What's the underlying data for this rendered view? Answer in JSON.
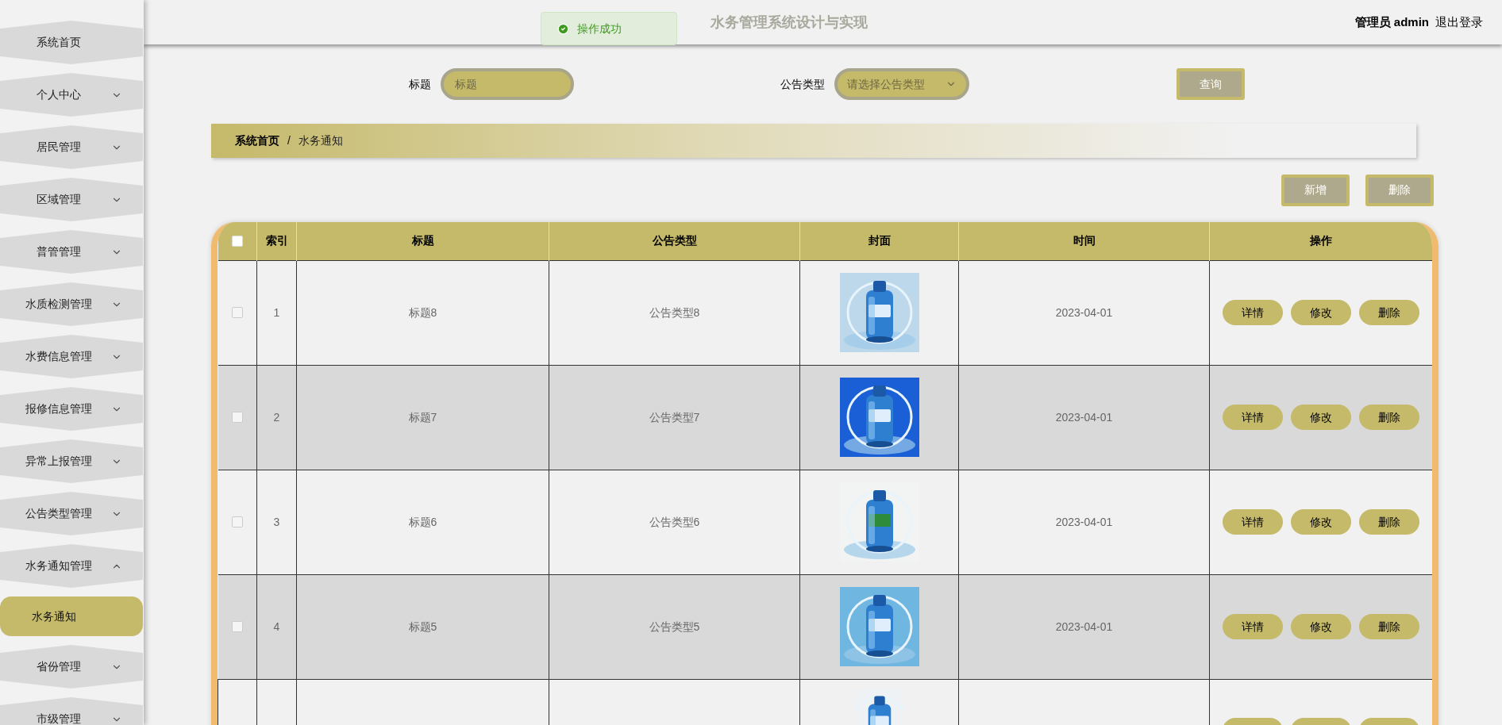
{
  "header": {
    "title": "水务管理系统设计与实现",
    "user": "管理员 admin",
    "logout": "退出登录"
  },
  "toast": {
    "message": "操作成功"
  },
  "sidebar": {
    "items": [
      {
        "label": "系统首页",
        "kind": "link"
      },
      {
        "label": "个人中心",
        "kind": "menu",
        "expanded": false
      },
      {
        "label": "居民管理",
        "kind": "menu",
        "expanded": false
      },
      {
        "label": "区域管理",
        "kind": "menu",
        "expanded": false
      },
      {
        "label": "普管管理",
        "kind": "menu",
        "expanded": false
      },
      {
        "label": "水质检测管理",
        "kind": "menu",
        "expanded": false
      },
      {
        "label": "水费信息管理",
        "kind": "menu",
        "expanded": false
      },
      {
        "label": "报修信息管理",
        "kind": "menu",
        "expanded": false
      },
      {
        "label": "异常上报管理",
        "kind": "menu",
        "expanded": false
      },
      {
        "label": "公告类型管理",
        "kind": "menu",
        "expanded": false
      },
      {
        "label": "水务通知管理",
        "kind": "menu",
        "expanded": true,
        "children": [
          {
            "label": "水务通知",
            "selected": true
          }
        ]
      },
      {
        "label": "省份管理",
        "kind": "menu",
        "expanded": false
      },
      {
        "label": "市级管理",
        "kind": "menu",
        "expanded": false
      }
    ]
  },
  "search": {
    "title_label": "标题",
    "title_placeholder": "标题",
    "type_label": "公告类型",
    "type_placeholder": "请选择公告类型",
    "query_button": "查询"
  },
  "breadcrumb": {
    "items": [
      "系统首页",
      "水务通知"
    ],
    "separator": "/"
  },
  "toolbar": {
    "add_button": "新增",
    "delete_button": "删除"
  },
  "table": {
    "columns": [
      "索引",
      "标题",
      "公告类型",
      "封面",
      "时间",
      "操作"
    ],
    "header_checked": false,
    "rows": [
      {
        "index": "1",
        "title": "标题8",
        "type": "公告类型8",
        "time": "2023-04-01",
        "actions": [
          "详情",
          "修改",
          "删除"
        ],
        "checked": false
      },
      {
        "index": "2",
        "title": "标题7",
        "type": "公告类型7",
        "time": "2023-04-01",
        "actions": [
          "详情",
          "修改",
          "删除"
        ],
        "checked": false
      },
      {
        "index": "3",
        "title": "标题6",
        "type": "公告类型6",
        "time": "2023-04-01",
        "actions": [
          "详情",
          "修改",
          "删除"
        ],
        "checked": false
      },
      {
        "index": "4",
        "title": "标题5",
        "type": "公告类型5",
        "time": "2023-04-01",
        "actions": [
          "详情",
          "修改",
          "删除"
        ],
        "checked": false
      },
      {
        "kind": "clipped"
      }
    ]
  }
}
